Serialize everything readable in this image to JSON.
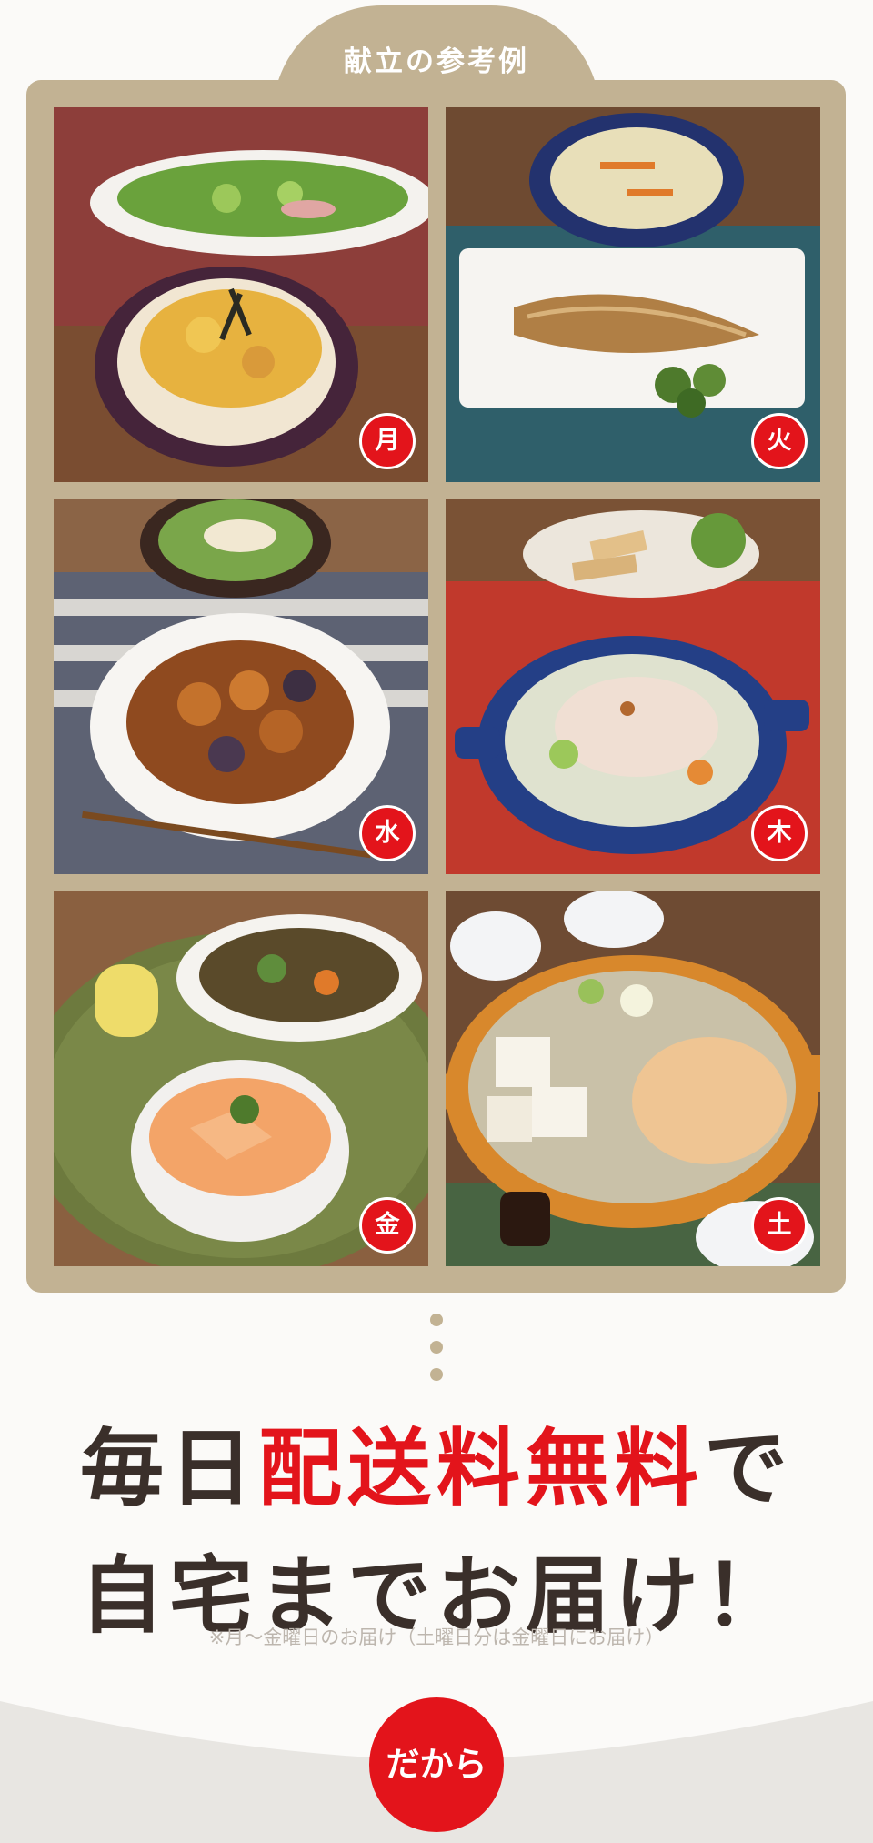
{
  "menu_panel": {
    "title": "献立の参考例",
    "days": [
      {
        "label": "月",
        "dish": "oyakodon-with-salad"
      },
      {
        "label": "火",
        "dish": "grilled-mackerel-with-stirfry"
      },
      {
        "label": "水",
        "dish": "sweet-sour-pork-with-salad"
      },
      {
        "label": "木",
        "dish": "pork-shabu-salad"
      },
      {
        "label": "金",
        "dish": "salmon-don-with-simmered-veg"
      },
      {
        "label": "土",
        "dish": "gyoza-hot-pot"
      }
    ]
  },
  "headline": {
    "line1_pre": "毎日",
    "line1_red": "配送料無料",
    "line1_post": "で",
    "line2": "自宅までお届け！"
  },
  "note": "※月〜金曜日のお届け（土曜日分は金曜日にお届け）",
  "bottom": {
    "badge_label": "だから"
  },
  "colors": {
    "panel": "#c2b293",
    "accent_red": "#e3141b",
    "text_dark": "#3a2f2a",
    "note_gray": "#bdb6ae"
  }
}
